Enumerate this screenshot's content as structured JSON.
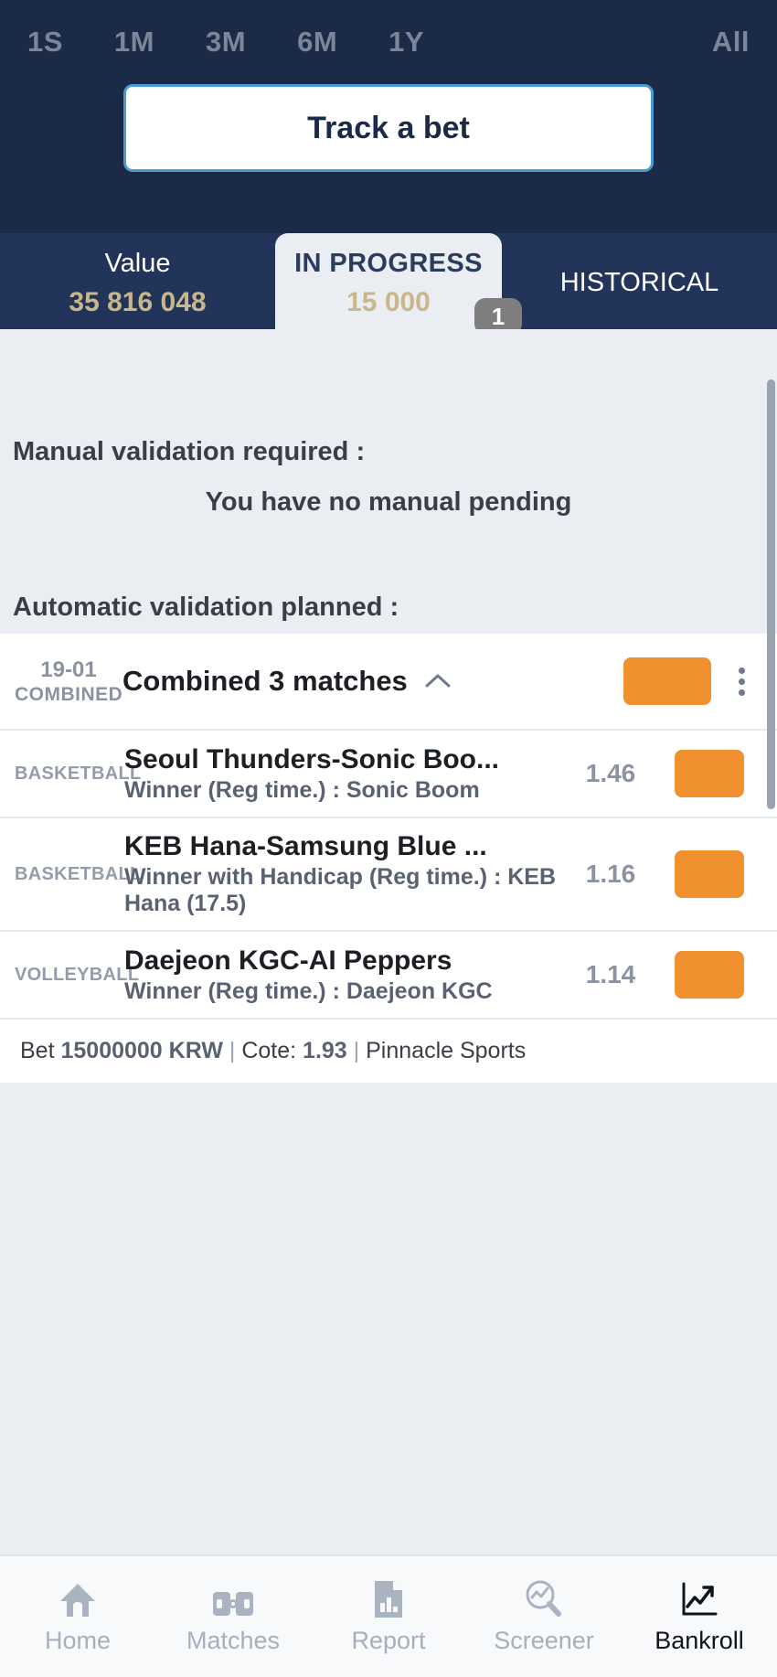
{
  "header": {
    "periods": [
      {
        "label": "1S"
      },
      {
        "label": "1M"
      },
      {
        "label": "3M"
      },
      {
        "label": "6M"
      },
      {
        "label": "1Y"
      },
      {
        "label": "All"
      }
    ],
    "track_button": "Track a bet"
  },
  "tabs": {
    "items": [
      {
        "label": "Value",
        "value": "35 816 048",
        "active": false
      },
      {
        "label": "IN PROGRESS",
        "value": "15 000",
        "active": true,
        "badge": "1"
      },
      {
        "label": "HISTORICAL",
        "value": "",
        "active": false
      }
    ]
  },
  "main": {
    "manual_title": "Manual validation required :",
    "manual_empty": "You have no manual pending",
    "auto_title": "Automatic validation planned :"
  },
  "bet": {
    "date": "19-01",
    "type": "COMBINED",
    "title": "Combined 3 matches",
    "chevron": "chevron-up",
    "status_color": "#f0902f",
    "matches": [
      {
        "sport": "BASKETBALL",
        "name": "Seoul Thunders-Sonic Boo...",
        "selection": "Winner (Reg time.) : Sonic Boom",
        "odd": "1.46"
      },
      {
        "sport": "BASKETBALL",
        "name": "KEB Hana-Samsung Blue ...",
        "selection": "Winner with Handicap (Reg time.) : KEB Hana (17.5)",
        "odd": "1.16"
      },
      {
        "sport": "VOLLEYBALL",
        "name": "Daejeon KGC-AI Peppers",
        "selection": "Winner (Reg time.) : Daejeon KGC",
        "odd": "1.14"
      }
    ],
    "footer": {
      "bet_label": "Bet",
      "bet_amount": "15000000 KRW",
      "sep1": "|",
      "cote_label": "Cote:",
      "cote_value": "1.93",
      "sep2": "|",
      "bookmaker": "Pinnacle Sports"
    }
  },
  "nav": {
    "items": [
      {
        "label": "Home",
        "icon": "home-icon",
        "active": false
      },
      {
        "label": "Matches",
        "icon": "matches-icon",
        "active": false
      },
      {
        "label": "Report",
        "icon": "report-icon",
        "active": false
      },
      {
        "label": "Screener",
        "icon": "screener-icon",
        "active": false
      },
      {
        "label": "Bankroll",
        "icon": "bankroll-icon",
        "active": true
      }
    ]
  }
}
